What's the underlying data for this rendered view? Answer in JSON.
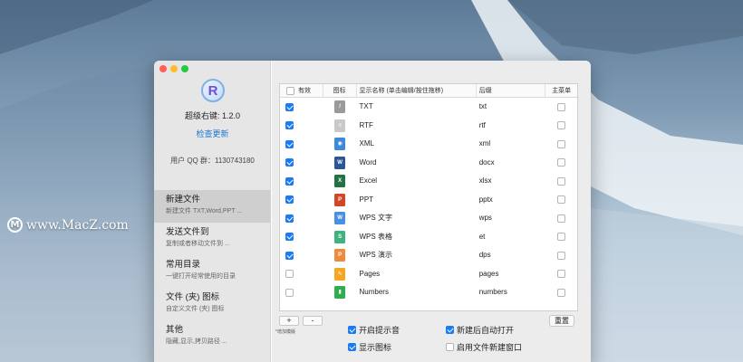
{
  "watermark": {
    "logo": "M",
    "text": "www.MacZ.com"
  },
  "app": {
    "logo_letter": "R",
    "name": "超级右键: 1.2.0",
    "check_update": "检查更新",
    "qq_group": "用户 QQ 群：1130743180"
  },
  "sidebar": {
    "items": [
      {
        "title": "新建文件",
        "subtitle": "新建文件 TXT,Word,PPT ...",
        "active": true
      },
      {
        "title": "发送文件到",
        "subtitle": "复制或者移动文件到 ...",
        "active": false
      },
      {
        "title": "常用目录",
        "subtitle": "一键打开经常使用的目录",
        "active": false
      },
      {
        "title": "文件 (夹) 图标",
        "subtitle": "自定义文件 (夹) 图标",
        "active": false
      },
      {
        "title": "其他",
        "subtitle": "隐藏,显示,拷贝路径 ...",
        "active": false
      }
    ]
  },
  "table": {
    "headers": {
      "enabled": "有效",
      "icon": "图标",
      "name": "显示名称 (单击编辑/按住拖移)",
      "ext": "后缀",
      "main_menu": "主菜单"
    },
    "rows": [
      {
        "enabled": true,
        "icon": "txt-file-icon",
        "icon_glyph": "/",
        "icon_color": "#9a9a9a",
        "name": "TXT",
        "ext": "txt",
        "main_menu": false
      },
      {
        "enabled": true,
        "icon": "rtf-file-icon",
        "icon_glyph": "≡",
        "icon_color": "#c9c9c9",
        "name": "RTF",
        "ext": "rtf",
        "main_menu": false
      },
      {
        "enabled": true,
        "icon": "xml-file-icon",
        "icon_glyph": "◉",
        "icon_color": "#3d8ad8",
        "name": "XML",
        "ext": "xml",
        "main_menu": false
      },
      {
        "enabled": true,
        "icon": "word-file-icon",
        "icon_glyph": "W",
        "icon_color": "#2b579a",
        "name": "Word",
        "ext": "docx",
        "main_menu": false
      },
      {
        "enabled": true,
        "icon": "excel-file-icon",
        "icon_glyph": "X",
        "icon_color": "#217346",
        "name": "Excel",
        "ext": "xlsx",
        "main_menu": false
      },
      {
        "enabled": true,
        "icon": "powerpoint-file-icon",
        "icon_glyph": "P",
        "icon_color": "#d24726",
        "name": "PPT",
        "ext": "pptx",
        "main_menu": false
      },
      {
        "enabled": true,
        "icon": "wps-writer-file-icon",
        "icon_glyph": "W",
        "icon_color": "#4a90e2",
        "name": "WPS 文字",
        "ext": "wps",
        "main_menu": false
      },
      {
        "enabled": true,
        "icon": "wps-sheet-file-icon",
        "icon_glyph": "S",
        "icon_color": "#3fb37f",
        "name": "WPS 表格",
        "ext": "et",
        "main_menu": false
      },
      {
        "enabled": true,
        "icon": "wps-presentation-file-icon",
        "icon_glyph": "P",
        "icon_color": "#f08a3c",
        "name": "WPS 演示",
        "ext": "dps",
        "main_menu": false
      },
      {
        "enabled": false,
        "icon": "pages-file-icon",
        "icon_glyph": "✎",
        "icon_color": "#f5a623",
        "name": "Pages",
        "ext": "pages",
        "main_menu": false
      },
      {
        "enabled": false,
        "icon": "numbers-file-icon",
        "icon_glyph": "▮",
        "icon_color": "#2fae4e",
        "name": "Numbers",
        "ext": "numbers",
        "main_menu": false
      }
    ]
  },
  "controls": {
    "add": "+",
    "remove": "-",
    "add_note": "*增加模版",
    "open_sound": {
      "label": "开启提示音",
      "checked": true
    },
    "auto_open": {
      "label": "新建后自动打开",
      "checked": true
    },
    "show_icon": {
      "label": "显示图标",
      "checked": true
    },
    "new_window": {
      "label": "启用文件新建窗口",
      "checked": false
    },
    "reset": "重置"
  }
}
